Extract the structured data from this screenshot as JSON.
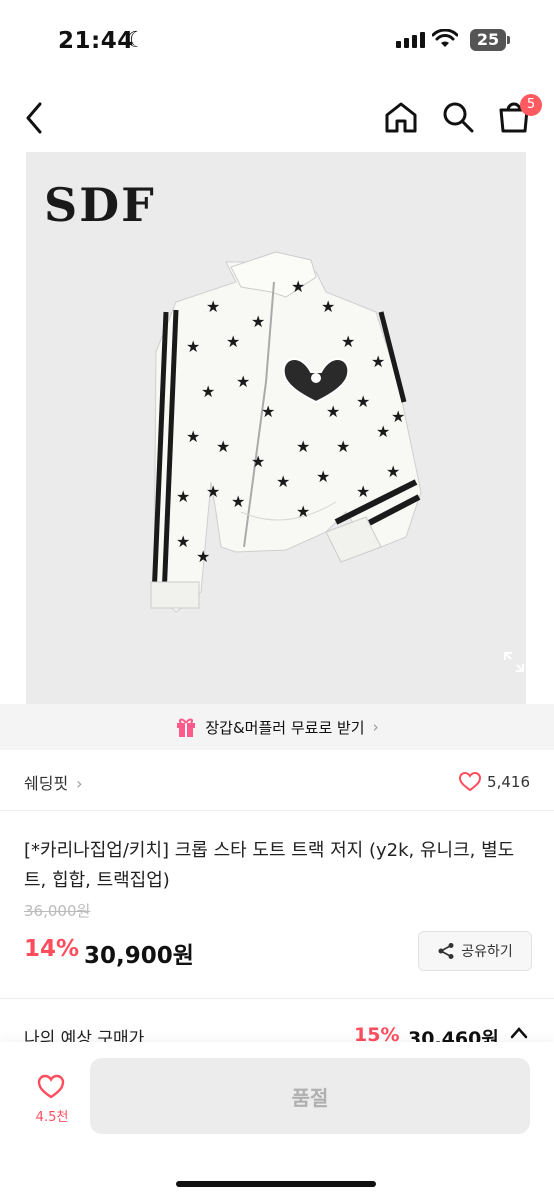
{
  "status": {
    "time": "21:44",
    "battery": "25"
  },
  "header": {
    "cart_count": "5"
  },
  "product": {
    "brand_logo": "SDF"
  },
  "promo": {
    "text": "장갑&머플러 무료로 받기"
  },
  "store": {
    "name": "쉐딩핏",
    "likes": "5,416"
  },
  "item": {
    "title": "[*카리나집업/키치] 크롭 스타 도트 트랙 저지 (y2k, 유니크, 별도트, 힙합, 트랙집업)",
    "original_price": "36,000원",
    "discount": "14%",
    "price": "30,900원",
    "share_label": "공유하기"
  },
  "expected": {
    "label": "나의 예상 구매가",
    "discount": "15%",
    "price": "30,460원"
  },
  "bottom": {
    "wish_count": "4.5천",
    "soldout_label": "품절"
  },
  "colors": {
    "accent": "#ff4d5e",
    "badge": "#ff5a5f"
  }
}
